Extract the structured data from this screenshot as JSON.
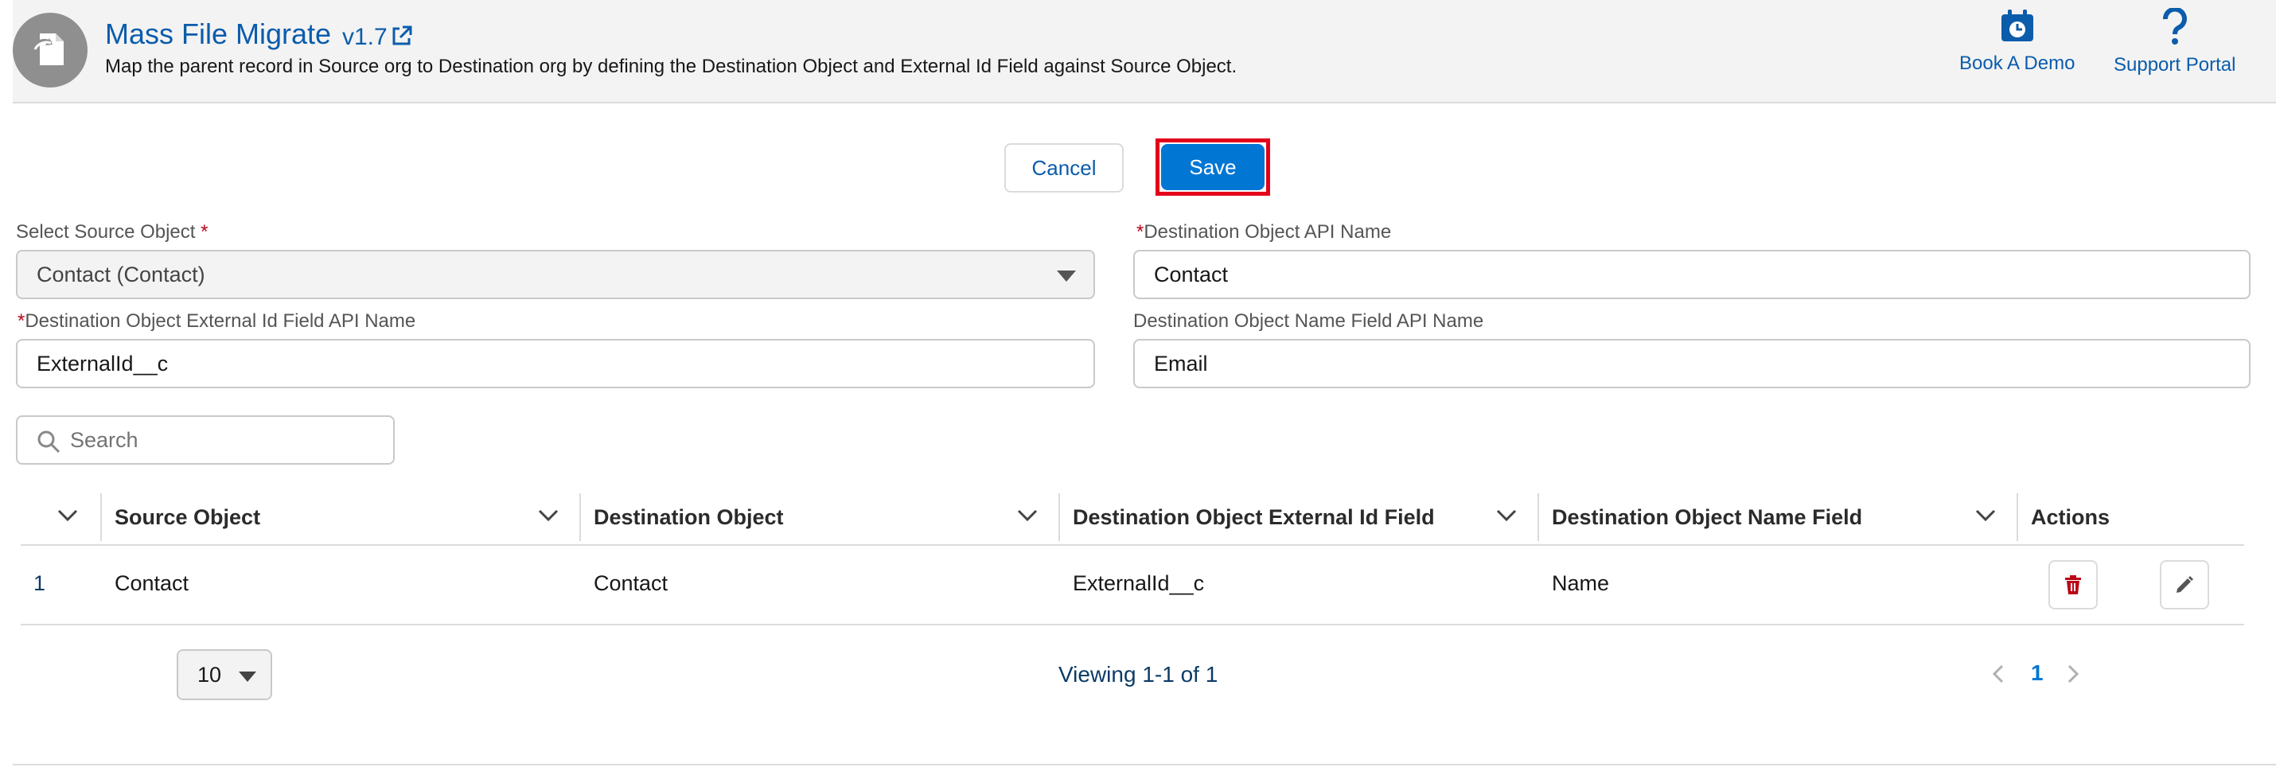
{
  "header": {
    "title": "Mass File Migrate",
    "version": "v1.7",
    "description": "Map the parent record in Source org to Destination org by defining the Destination Object and External Id Field against Source Object.",
    "actions": [
      {
        "label": "Book A Demo",
        "icon": "calendar-clock-icon"
      },
      {
        "label": "Support Portal",
        "icon": "question-mark-icon"
      }
    ]
  },
  "buttons": {
    "cancel": "Cancel",
    "save": "Save"
  },
  "form": {
    "source_object": {
      "label": "Select Source Object",
      "required": "*",
      "value": "Contact (Contact)"
    },
    "dest_object_api": {
      "label": "Destination Object API Name",
      "required": "*",
      "value": "Contact"
    },
    "dest_external_id": {
      "label": "Destination Object External Id Field API Name",
      "required": "*",
      "value": "ExternalId__c"
    },
    "dest_name_field": {
      "label": "Destination Object Name Field API Name",
      "value": "Email"
    }
  },
  "search": {
    "placeholder": "Search"
  },
  "table": {
    "columns": [
      "Source Object",
      "Destination Object",
      "Destination Object External Id Field",
      "Destination Object Name Field",
      "Actions"
    ],
    "rows": [
      {
        "num": "1",
        "source": "Contact",
        "destination": "Contact",
        "external_id": "ExternalId__c",
        "name_field": "Name"
      }
    ]
  },
  "pagination": {
    "page_size": "10",
    "viewing": "Viewing 1-1 of 1",
    "current_page": "1"
  },
  "colors": {
    "brand": "#0176d3",
    "link": "#0b5cab",
    "delete": "#ba0517",
    "highlight": "#e3001b"
  }
}
